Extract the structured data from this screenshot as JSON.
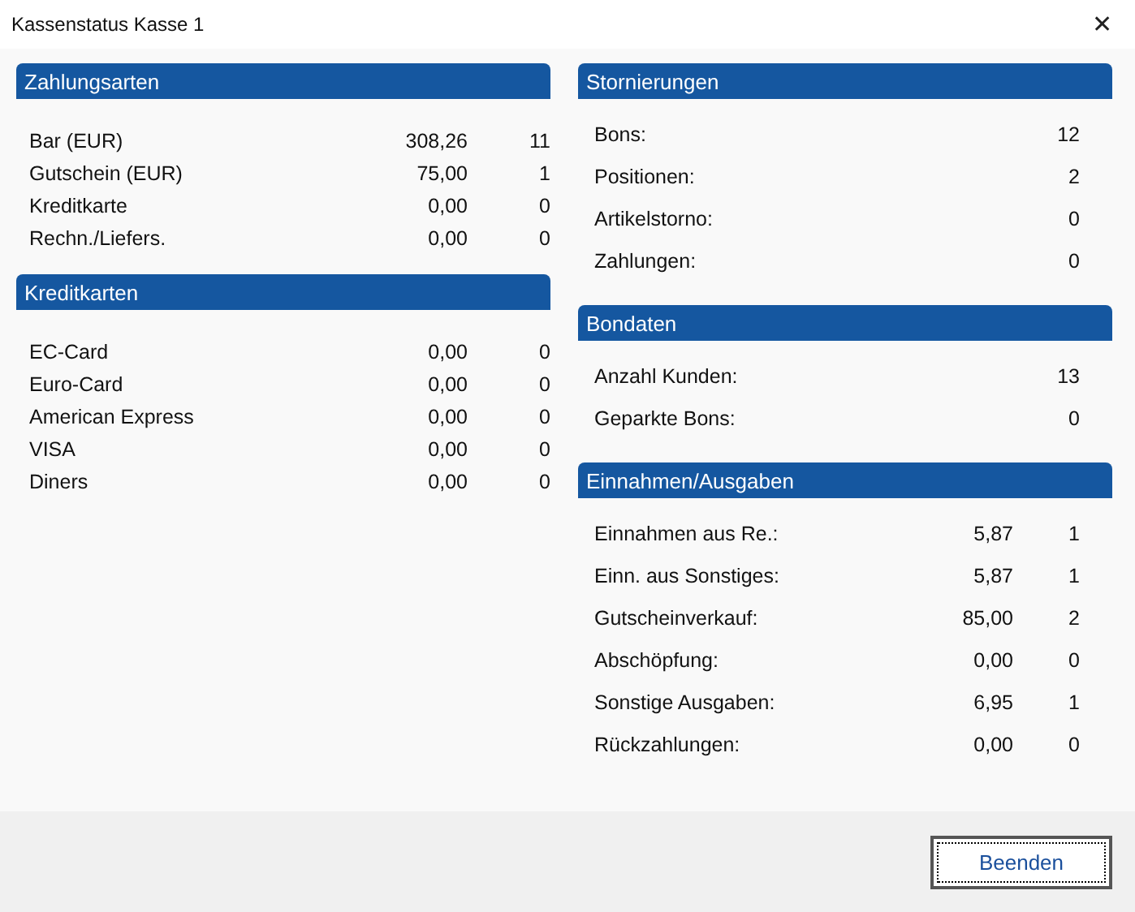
{
  "window": {
    "title": "Kassenstatus Kasse 1",
    "close": "✕"
  },
  "left": [
    {
      "title": "Zahlungsarten",
      "rows": [
        {
          "label": "Bar (EUR)",
          "amount": "308,26",
          "count": "11"
        },
        {
          "label": "Gutschein (EUR)",
          "amount": "75,00",
          "count": "1"
        },
        {
          "label": "Kreditkarte",
          "amount": "0,00",
          "count": "0"
        },
        {
          "label": "Rechn./Liefers.",
          "amount": "0,00",
          "count": "0"
        }
      ]
    },
    {
      "title": "Kreditkarten",
      "rows": [
        {
          "label": "EC-Card",
          "amount": "0,00",
          "count": "0"
        },
        {
          "label": "Euro-Card",
          "amount": "0,00",
          "count": "0"
        },
        {
          "label": "American Express",
          "amount": "0,00",
          "count": "0"
        },
        {
          "label": "VISA",
          "amount": "0,00",
          "count": "0"
        },
        {
          "label": "Diners",
          "amount": "0,00",
          "count": "0"
        }
      ]
    }
  ],
  "right": [
    {
      "title": "Stornierungen",
      "rows": [
        {
          "label": "Bons:",
          "count": "12"
        },
        {
          "label": "Positionen:",
          "count": "2"
        },
        {
          "label": "Artikelstorno:",
          "count": "0"
        },
        {
          "label": "Zahlungen:",
          "count": "0"
        }
      ]
    },
    {
      "title": "Bondaten",
      "rows": [
        {
          "label": "Anzahl Kunden:",
          "count": "13"
        },
        {
          "label": "Geparkte Bons:",
          "count": "0"
        }
      ]
    },
    {
      "title": "Einnahmen/Ausgaben",
      "rows": [
        {
          "label": "Einnahmen aus Re.:",
          "amount": "5,87",
          "count": "1"
        },
        {
          "label": "Einn. aus Sonstiges:",
          "amount": "5,87",
          "count": "1"
        },
        {
          "label": "Gutscheinverkauf:",
          "amount": "85,00",
          "count": "2"
        },
        {
          "label": "Abschöpfung:",
          "amount": "0,00",
          "count": "0"
        },
        {
          "label": "Sonstige Ausgaben:",
          "amount": "6,95",
          "count": "1"
        },
        {
          "label": "Rückzahlungen:",
          "amount": "0,00",
          "count": "0"
        }
      ]
    }
  ],
  "buttons": [
    "Beenden"
  ]
}
